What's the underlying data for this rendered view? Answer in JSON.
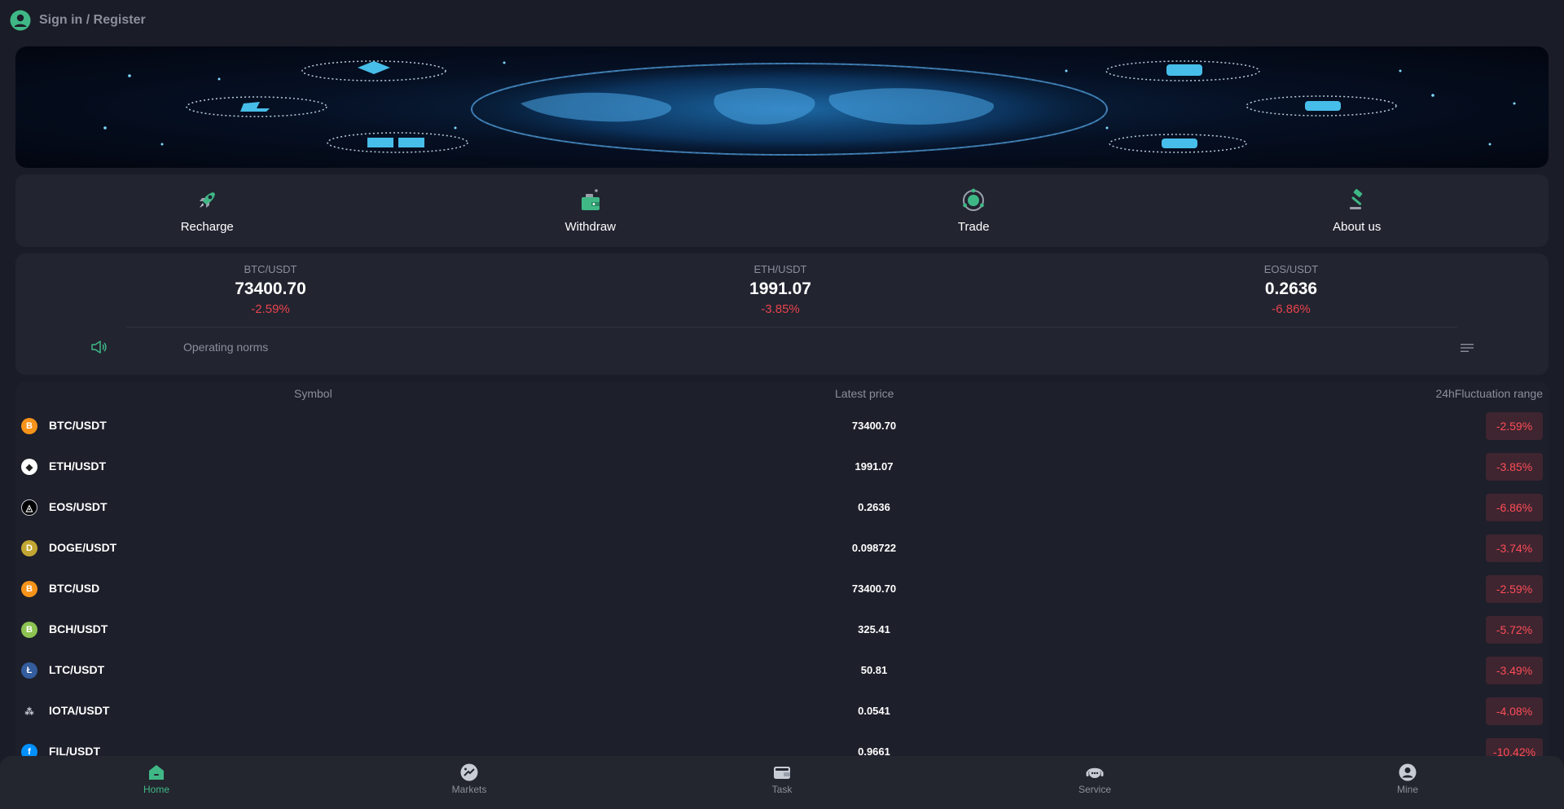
{
  "header": {
    "sign_in_label": "Sign in / Register"
  },
  "colors": {
    "accent": "#3fb886",
    "negative": "#e8434c",
    "panel": "#222430",
    "background": "#1a1c27"
  },
  "actions": [
    {
      "label": "Recharge",
      "icon": "rocket-icon"
    },
    {
      "label": "Withdraw",
      "icon": "wallet-icon"
    },
    {
      "label": "Trade",
      "icon": "trade-orbit-icon"
    },
    {
      "label": "About us",
      "icon": "gavel-icon"
    }
  ],
  "tickers": [
    {
      "pair": "BTC/USDT",
      "price": "73400.70",
      "change": "-2.59%"
    },
    {
      "pair": "ETH/USDT",
      "price": "1991.07",
      "change": "-3.85%"
    },
    {
      "pair": "EOS/USDT",
      "price": "0.2636",
      "change": "-6.86%"
    }
  ],
  "notice": {
    "text": "Operating norms"
  },
  "market": {
    "headers": {
      "symbol": "Symbol",
      "price": "Latest price",
      "range": "24hFluctuation range"
    },
    "rows": [
      {
        "symbol": "BTC/USDT",
        "price": "73400.70",
        "change": "-2.59%",
        "icon": "bitcoin-icon",
        "glyph": "B",
        "color": "#f7931a"
      },
      {
        "symbol": "ETH/USDT",
        "price": "1991.07",
        "change": "-3.85%",
        "icon": "ethereum-icon",
        "glyph": "◆",
        "color": "#ffffff"
      },
      {
        "symbol": "EOS/USDT",
        "price": "0.2636",
        "change": "-6.86%",
        "icon": "eos-icon",
        "glyph": "◬",
        "color": "#000000"
      },
      {
        "symbol": "DOGE/USDT",
        "price": "0.098722",
        "change": "-3.74%",
        "icon": "dogecoin-icon",
        "glyph": "D",
        "color": "#c2a633"
      },
      {
        "symbol": "BTC/USD",
        "price": "73400.70",
        "change": "-2.59%",
        "icon": "bitcoin-icon",
        "glyph": "B",
        "color": "#f7931a"
      },
      {
        "symbol": "BCH/USDT",
        "price": "325.41",
        "change": "-5.72%",
        "icon": "bitcoin-cash-icon",
        "glyph": "B",
        "color": "#8dc351"
      },
      {
        "symbol": "LTC/USDT",
        "price": "50.81",
        "change": "-3.49%",
        "icon": "litecoin-icon",
        "glyph": "Ł",
        "color": "#345d9d"
      },
      {
        "symbol": "IOTA/USDT",
        "price": "0.0541",
        "change": "-4.08%",
        "icon": "iota-icon",
        "glyph": "⁂",
        "color": "#1d1f2a"
      },
      {
        "symbol": "FIL/USDT",
        "price": "0.9661",
        "change": "-10.42%",
        "icon": "filecoin-icon",
        "glyph": "f",
        "color": "#0090ff"
      }
    ]
  },
  "bottom_nav": [
    {
      "label": "Home",
      "icon": "home-icon",
      "active": true
    },
    {
      "label": "Markets",
      "icon": "markets-icon",
      "active": false
    },
    {
      "label": "Task",
      "icon": "task-icon",
      "active": false
    },
    {
      "label": "Service",
      "icon": "service-icon",
      "active": false
    },
    {
      "label": "Mine",
      "icon": "user-icon",
      "active": false
    }
  ]
}
